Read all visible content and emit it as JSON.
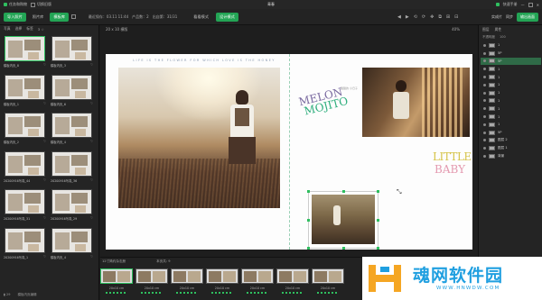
{
  "titlebar": {
    "left_items": [
      "任务和购物",
      "切换旧版"
    ],
    "title": "青春",
    "right_items": [
      "快速手册"
    ]
  },
  "toolbar": {
    "import_btn": "导入照片",
    "btn_photos": "照片库",
    "btn_templates": "模板库",
    "info_saved": "最近保存：03.11 11:44",
    "info_products": "产品数：2",
    "info_page": "出自第：31/31",
    "mode_preview": "看看模式",
    "mode_design": "设计模式",
    "right_btn1": "实成片",
    "right_btn2": "同步",
    "right_btn3": "输出画面",
    "icons": [
      "◀",
      "▶",
      "⟲",
      "⟳",
      "✥",
      "⧉",
      "⊞",
      "⊟"
    ]
  },
  "left_panel": {
    "tabs": [
      "写真",
      "选择",
      "标签",
      "3 ☆"
    ],
    "thumbs": [
      {
        "label": "模板内页_8"
      },
      {
        "label": "模板内页_3"
      },
      {
        "label": "模板内页_1"
      },
      {
        "label": "模板内页_6"
      },
      {
        "label": "模板内页_2"
      },
      {
        "label": "模板内页_4"
      },
      {
        "label": "20200916写真_44"
      },
      {
        "label": "20200916写真_36"
      },
      {
        "label": "20200916写真_31"
      },
      {
        "label": "20200916写真_29"
      },
      {
        "label": "20200916写真_1"
      },
      {
        "label": "模板内页_4"
      }
    ],
    "bottom": [
      "▮ 29",
      "模板内页编辑"
    ]
  },
  "work_area": {
    "size_label": "20 x 10 横版",
    "zoom": "40%",
    "tagline": "LIFE IS THE FLOWER FOR WHICH LOVE IS THE HONEY",
    "melon": "MELON",
    "mojito": "MOJITO",
    "small_text": "甜甜的 小日子",
    "little": "LITTLE",
    "baby": "BABY"
  },
  "right_panel": {
    "tabs": [
      "图层",
      "属性"
    ],
    "sub": [
      "不透明度",
      "100"
    ],
    "layers": [
      {
        "name": "1",
        "selected": false
      },
      {
        "name": "5P",
        "selected": false
      },
      {
        "name": "5P",
        "selected": true
      },
      {
        "name": "1",
        "selected": false
      },
      {
        "name": "1",
        "selected": false
      },
      {
        "name": "1",
        "selected": false
      },
      {
        "name": "1",
        "selected": false
      },
      {
        "name": "1",
        "selected": false
      },
      {
        "name": "1",
        "selected": false
      },
      {
        "name": "1",
        "selected": false
      },
      {
        "name": "1",
        "selected": false
      },
      {
        "name": "5P",
        "selected": false
      },
      {
        "name": "图层 2",
        "selected": false
      },
      {
        "name": "图层 1",
        "selected": false
      },
      {
        "name": "背景",
        "selected": false
      }
    ]
  },
  "filmstrip": {
    "header": "12寸简约杂志册",
    "page_count": "本页共: 9",
    "items": [
      "20x10 cm",
      "20x10 cm",
      "20x10 cm",
      "20x10 cm",
      "20x10 cm",
      "20x10 cm",
      "20x10 cm"
    ]
  },
  "watermark": {
    "text": "魂网软件园",
    "url": "WWW.HNWDW.COM"
  }
}
